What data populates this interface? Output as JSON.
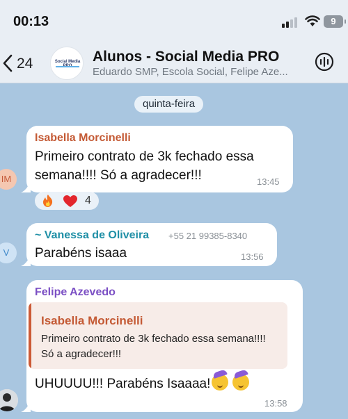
{
  "status_bar": {
    "time": "00:13",
    "battery": "9"
  },
  "header": {
    "back_count": "24",
    "title": "Alunos - Social Media PRO",
    "subtitle": "Eduardo SMP, Escola Social, Felipe Aze...",
    "avatar_logo_text": "Social Media PRO"
  },
  "date_separator": "quinta-feira",
  "colors": {
    "chat_background": "#a9c6e0",
    "isabella": "#c45a35",
    "vanessa": "#1f8fa6",
    "felipe": "#7b4fc4",
    "header_background": "#e9eef4"
  },
  "messages": [
    {
      "sender": "Isabella Morcinelli",
      "avatar_initials": "IM",
      "text_line1": "Primeiro contrato de 3k fechado essa",
      "text_line2": "semana!!!! Só a agradecer!!!",
      "time": "13:45",
      "reactions": {
        "emojis": [
          "fire",
          "red-heart"
        ],
        "count": "4"
      }
    },
    {
      "sender": "~ Vanessa de Oliveira",
      "phone": "+55 21 99385-8340",
      "avatar_initials": "V",
      "text": "Parabéns isaaa",
      "time": "13:56"
    },
    {
      "sender": "Felipe Azevedo",
      "quote": {
        "sender": "Isabella Morcinelli",
        "text_line1": "Primeiro contrato de 3k fechado essa semana!!!!",
        "text_line2": "Só a agradecer!!!"
      },
      "text": "UHUUUU!!! Parabéns Isaaaa!",
      "emojis": [
        "partying-face",
        "partying-face"
      ],
      "time": "13:58"
    }
  ]
}
